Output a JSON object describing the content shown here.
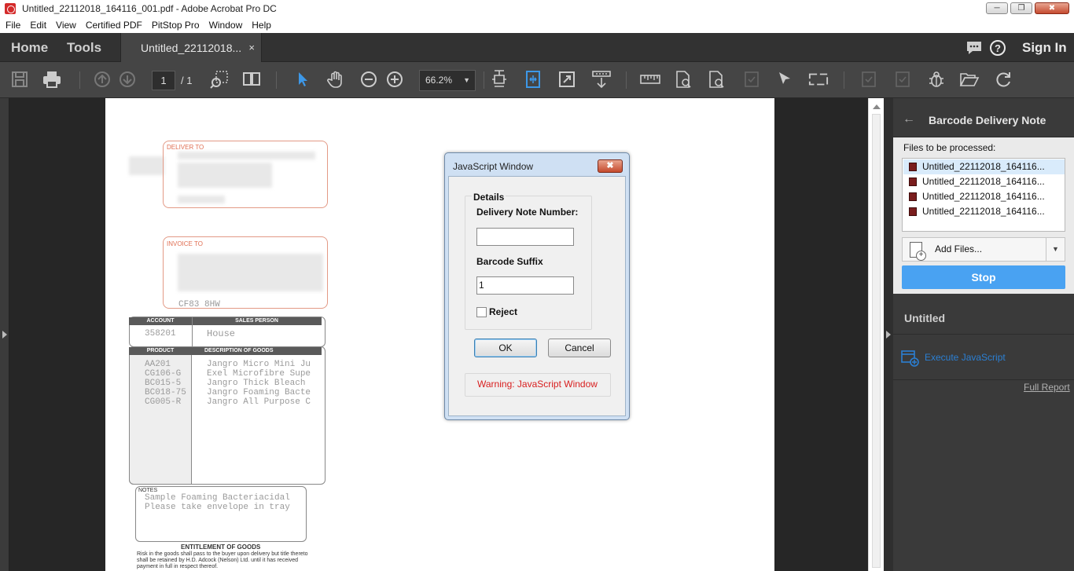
{
  "window": {
    "title": "Untitled_22112018_164116_001.pdf - Adobe Acrobat Pro DC"
  },
  "menu": [
    "File",
    "Edit",
    "View",
    "Certified PDF",
    "PitStop Pro",
    "Window",
    "Help"
  ],
  "nav": {
    "home": "Home",
    "tools": "Tools",
    "doc_tab": "Untitled_22112018...",
    "close": "×",
    "sign_in": "Sign In"
  },
  "toolbar": {
    "page_current": "1",
    "page_total": "/ 1",
    "zoom": "66.2%"
  },
  "document": {
    "deliver_to": "DELIVER TO",
    "invoice_to": "INVOICE TO",
    "postcode": "CF83 8HW",
    "account_hdr": "ACCOUNT",
    "sales_hdr": "SALES PERSON",
    "account_val": "358201",
    "sales_val": "House",
    "product_hdr": "PRODUCT",
    "desc_hdr": "DESCRIPTION OF GOODS",
    "products": "AA201\nCG106-G\nBC015-5\nBC018-75\nCG005-R",
    "descriptions": "Jangro Micro Mini Ju\nExel Microfibre Supe\nJangro Thick Bleach\nJangro Foaming Bacte\nJangro All Purpose C",
    "notes_hdr": "NOTES",
    "notes": "Sample Foaming Bacteriacidal\nPlease take envelope in tray",
    "entitlement": "ENTITLEMENT OF GOODS",
    "entitlement_text": "Risk in the goods shall pass to the buyer upon delivery but title thereto\nshall be retained by H.D. Adcock (Nelson) Ltd. until it has received\npayment in full in respect thereof."
  },
  "dialog": {
    "title": "JavaScript Window",
    "close": "✖",
    "group": "Details",
    "delivery_label": "Delivery Note Number:",
    "delivery_value": "",
    "suffix_label": "Barcode Suffix",
    "suffix_value": "1",
    "reject_label": "Reject",
    "ok": "OK",
    "cancel": "Cancel",
    "warning": "Warning: JavaScript Window"
  },
  "panel": {
    "title": "Barcode Delivery Note",
    "files_caption": "Files to be processed:",
    "files": [
      "Untitled_22112018_164116...",
      "Untitled_22112018_164116...",
      "Untitled_22112018_164116...",
      "Untitled_22112018_164116..."
    ],
    "add_files": "Add Files...",
    "stop": "Stop",
    "section": "Untitled",
    "action": "Execute JavaScript",
    "full_report": "Full Report"
  },
  "colors": {
    "accent": "#49a2f2",
    "dark_bg": "#3a3a3a",
    "warning": "#d81e1e"
  }
}
